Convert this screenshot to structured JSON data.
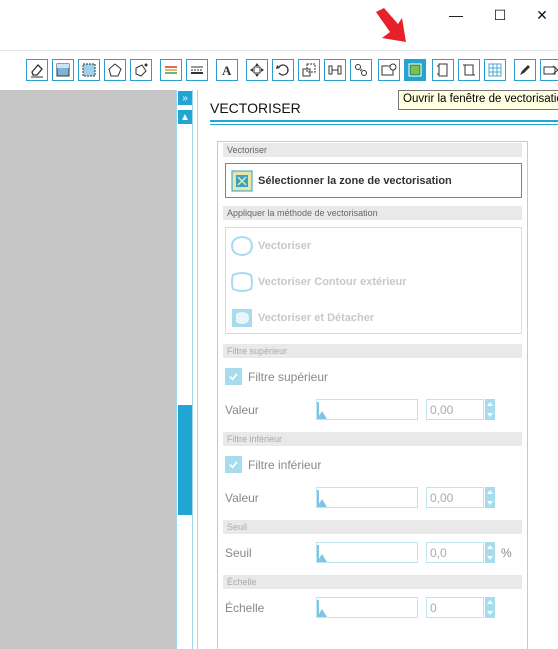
{
  "window": {
    "minimize_glyph": "—",
    "maximize_glyph": "☐",
    "close_glyph": "✕"
  },
  "toolbar": {
    "icons": [
      "eraser-icon",
      "fill-rect-icon",
      "pattern-fill-icon",
      "polygon-paint-icon",
      "pen-polygon-icon",
      "line-color-icon",
      "line-style-icon",
      "text-icon",
      "move-icon",
      "rotate-icon",
      "scale-icon",
      "align-icon",
      "replicate-icon",
      "image-icon",
      "trace-window-icon",
      "page-icon",
      "crop-icon",
      "grid-icon",
      "pen-icon",
      "send-icon"
    ],
    "active_icon": "trace-window-icon",
    "tooltip": "Ouvrir la fenêtre de vectorisation"
  },
  "scroll": {
    "collapse_glyph": "»",
    "up_glyph": "▲"
  },
  "panel": {
    "title": "VECTORISER",
    "section_vectoriser": "Vectoriser",
    "select_area_label": "Sélectionner la zone de vectorisation",
    "section_method": "Appliquer la méthode de vectorisation",
    "method_vectoriser": "Vectoriser",
    "method_outline": "Vectoriser Contour extérieur",
    "method_detach": "Vectoriser et Détacher",
    "section_high_filter": "Filtre supérieur",
    "high_filter_label": "Filtre supérieur",
    "high_value_label": "Valeur",
    "high_value": "0,00",
    "section_low_filter": "Filtre inférieur",
    "low_filter_label": "Filtre inférieur",
    "low_value_label": "Valeur",
    "low_value": "0,00",
    "section_threshold": "Seuil",
    "threshold_label": "Seuil",
    "threshold_value": "0,0",
    "threshold_unit": "%",
    "section_scale": "Échelle",
    "scale_label": "Échelle",
    "scale_value": "0"
  },
  "colors": {
    "accent": "#21a6d4",
    "annotation_arrow": "#e8202a"
  }
}
